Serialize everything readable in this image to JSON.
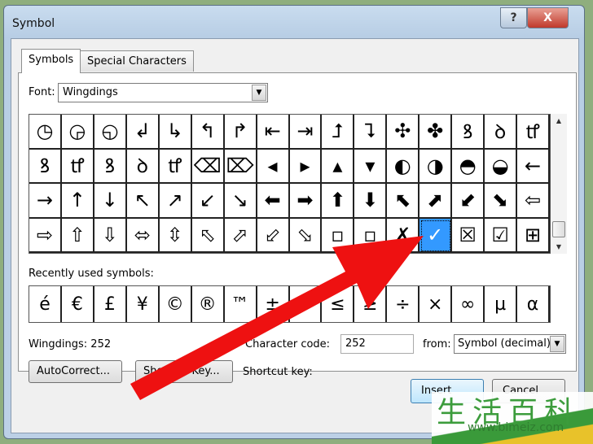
{
  "window": {
    "title": "Symbol",
    "help": "?",
    "close": "X"
  },
  "tabs": [
    {
      "label": "Symbols",
      "active": true
    },
    {
      "label": "Special Characters",
      "active": false
    }
  ],
  "font": {
    "label": "Font:",
    "value": "Wingdings"
  },
  "symbols": [
    [
      "◷",
      "◶",
      "◵",
      "↲",
      "↳",
      "↰",
      "↱",
      "⇤",
      "⇥",
      "⮥",
      "⮧",
      "✣",
      "✤",
      "ꝸ",
      "ꝺ",
      "ꝷ"
    ],
    [
      "ꝸ",
      "ꝷ",
      "ꝸ",
      "ꝺ",
      "ꝷ",
      "⌫",
      "⌦",
      "◂",
      "▸",
      "▴",
      "▾",
      "◐",
      "◑",
      "◓",
      "◒",
      "←"
    ],
    [
      "→",
      "↑",
      "↓",
      "↖",
      "↗",
      "↙",
      "↘",
      "⬅",
      "➡",
      "⬆",
      "⬇",
      "⬉",
      "⬈",
      "⬋",
      "⬊",
      "⇦"
    ],
    [
      "⇨",
      "⇧",
      "⇩",
      "⬄",
      "⇳",
      "⬁",
      "⬀",
      "⬃",
      "⬂",
      "▫",
      "▫",
      "✗",
      "✓",
      "☒",
      "☑",
      "⊞"
    ]
  ],
  "selected": {
    "row": 3,
    "col": 12
  },
  "recent": {
    "label": "Recently used symbols:",
    "items": [
      "é",
      "€",
      "£",
      "¥",
      "©",
      "®",
      "™",
      "±",
      "≠",
      "≤",
      "≥",
      "÷",
      "×",
      "∞",
      "µ",
      "α"
    ]
  },
  "status": {
    "name": "Wingdings: 252",
    "code_label": "Character code:",
    "code": "252",
    "from_label": "from:",
    "from": "Symbol (decimal)"
  },
  "buttons": {
    "autocorrect": "AutoCorrect...",
    "shortcut_key": "Shortcut Key...",
    "shortcut_label": "Shortcut key:",
    "insert": "Insert",
    "cancel": "Cancel"
  },
  "watermark": {
    "cn": "生活百科",
    "url": "www.bimeiz.com"
  },
  "colors": {
    "selection": "#3399ff",
    "annotation_arrow": "#ee1111"
  }
}
